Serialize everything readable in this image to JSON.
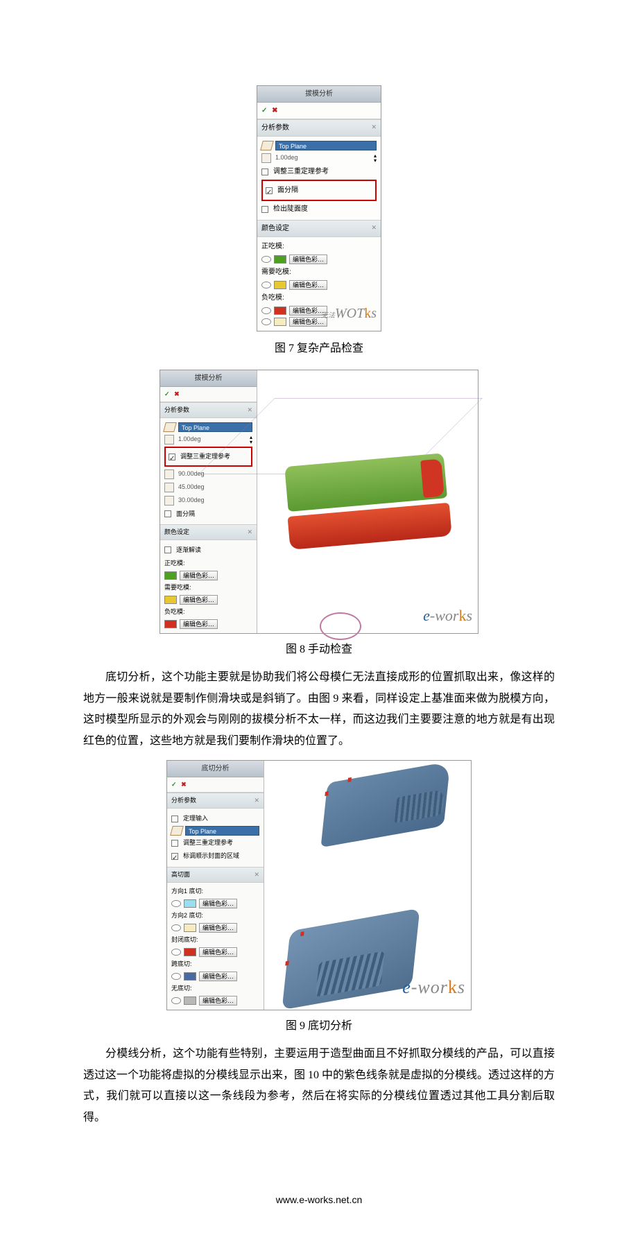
{
  "fig7": {
    "caption": "图 7 复杂产品检查",
    "panel": {
      "title": "拔模分析",
      "section_params": "分析参数",
      "top_plane": "Top Plane",
      "angle": "1.00deg",
      "adjust_label": "调整三重定理参考",
      "slider_label": "面分隔",
      "find_label": "检出陡面度",
      "section_colors": "颜色设定",
      "pos_draft": "正吃模:",
      "need_draft": "需要吃模:",
      "neg_draft": "负吃模:",
      "edit_btn": "编辑色彩…"
    }
  },
  "fig8": {
    "caption": "图 8 手动检查",
    "panel": {
      "title": "拔模分析",
      "section_params": "分析参数",
      "top_plane": "Top Plane",
      "angle": "1.00deg",
      "adjust_label": "调整三重定理参考",
      "v1": "90.00deg",
      "v2": "45.00deg",
      "v3": "30.00deg",
      "slider_label": "面分隔",
      "section_colors": "颜色设定",
      "smooth": "逐渐解读",
      "pos_draft": "正吃模:",
      "need_draft": "需要吃模:",
      "neg_draft": "负吃模:",
      "edit_btn": "编辑色彩…"
    },
    "watermark": "e-works"
  },
  "para1": "底切分析，这个功能主要就是协助我们将公母模仁无法直接成形的位置抓取出来，像这样的地方一般来说就是要制作侧滑块或是斜销了。由图 9 来看，同样设定上基准面来做为脱模方向，这时模型所显示的外观会与刚刚的拔模分析不太一样，而这边我们主要要注意的地方就是有出现红色的位置，这些地方就是我们要制作滑块的位置了。",
  "fig9": {
    "caption": "图 9 底切分析",
    "panel": {
      "title": "底切分析",
      "section_params": "分析参数",
      "coord_in": "定理输入",
      "top_plane": "Top Plane",
      "adjust_label": "调整三重定理参考",
      "highlight": "标调顺示封面的区域",
      "section_uc": "高切面",
      "d1": "方向1 底切:",
      "d2": "方向2 底切:",
      "both": "封闭底切:",
      "span": "跨底切:",
      "none": "无底切:",
      "edit_btn": "编辑色彩…"
    },
    "watermark": "e-works"
  },
  "para2": "分模线分析，这个功能有些特别，主要运用于造型曲面且不好抓取分模线的产品，可以直接透过这一个功能将虚拟的分模线显示出来，图 10 中的紫色线条就是虚拟的分模线。透过这样的方式，我们就可以直接以这一条线段为参考，然后在将实际的分模线位置透过其他工具分割后取得。",
  "footer": "www.e-works.net.cn"
}
